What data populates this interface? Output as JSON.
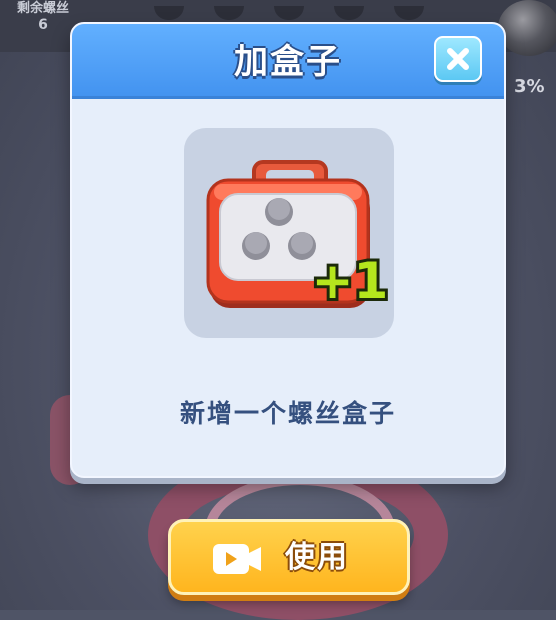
{
  "background": {
    "remaining_screws_label": "剩余螺丝",
    "remaining_screws_count": "6",
    "progress_text": "3%"
  },
  "dialog": {
    "title": "加盒子",
    "close_icon": "close-x-icon",
    "item": {
      "icon": "screw-box-icon",
      "bonus_text": "+1"
    },
    "description": "新增一个螺丝盒子"
  },
  "use_button": {
    "icon": "video-play-icon",
    "label": "使用"
  },
  "colors": {
    "header_blue": "#4a9cf5",
    "dialog_bg": "#e6eefa",
    "description_text": "#35507f",
    "button_yellow": "#ffc232",
    "bonus_green": "#b5e61d"
  }
}
